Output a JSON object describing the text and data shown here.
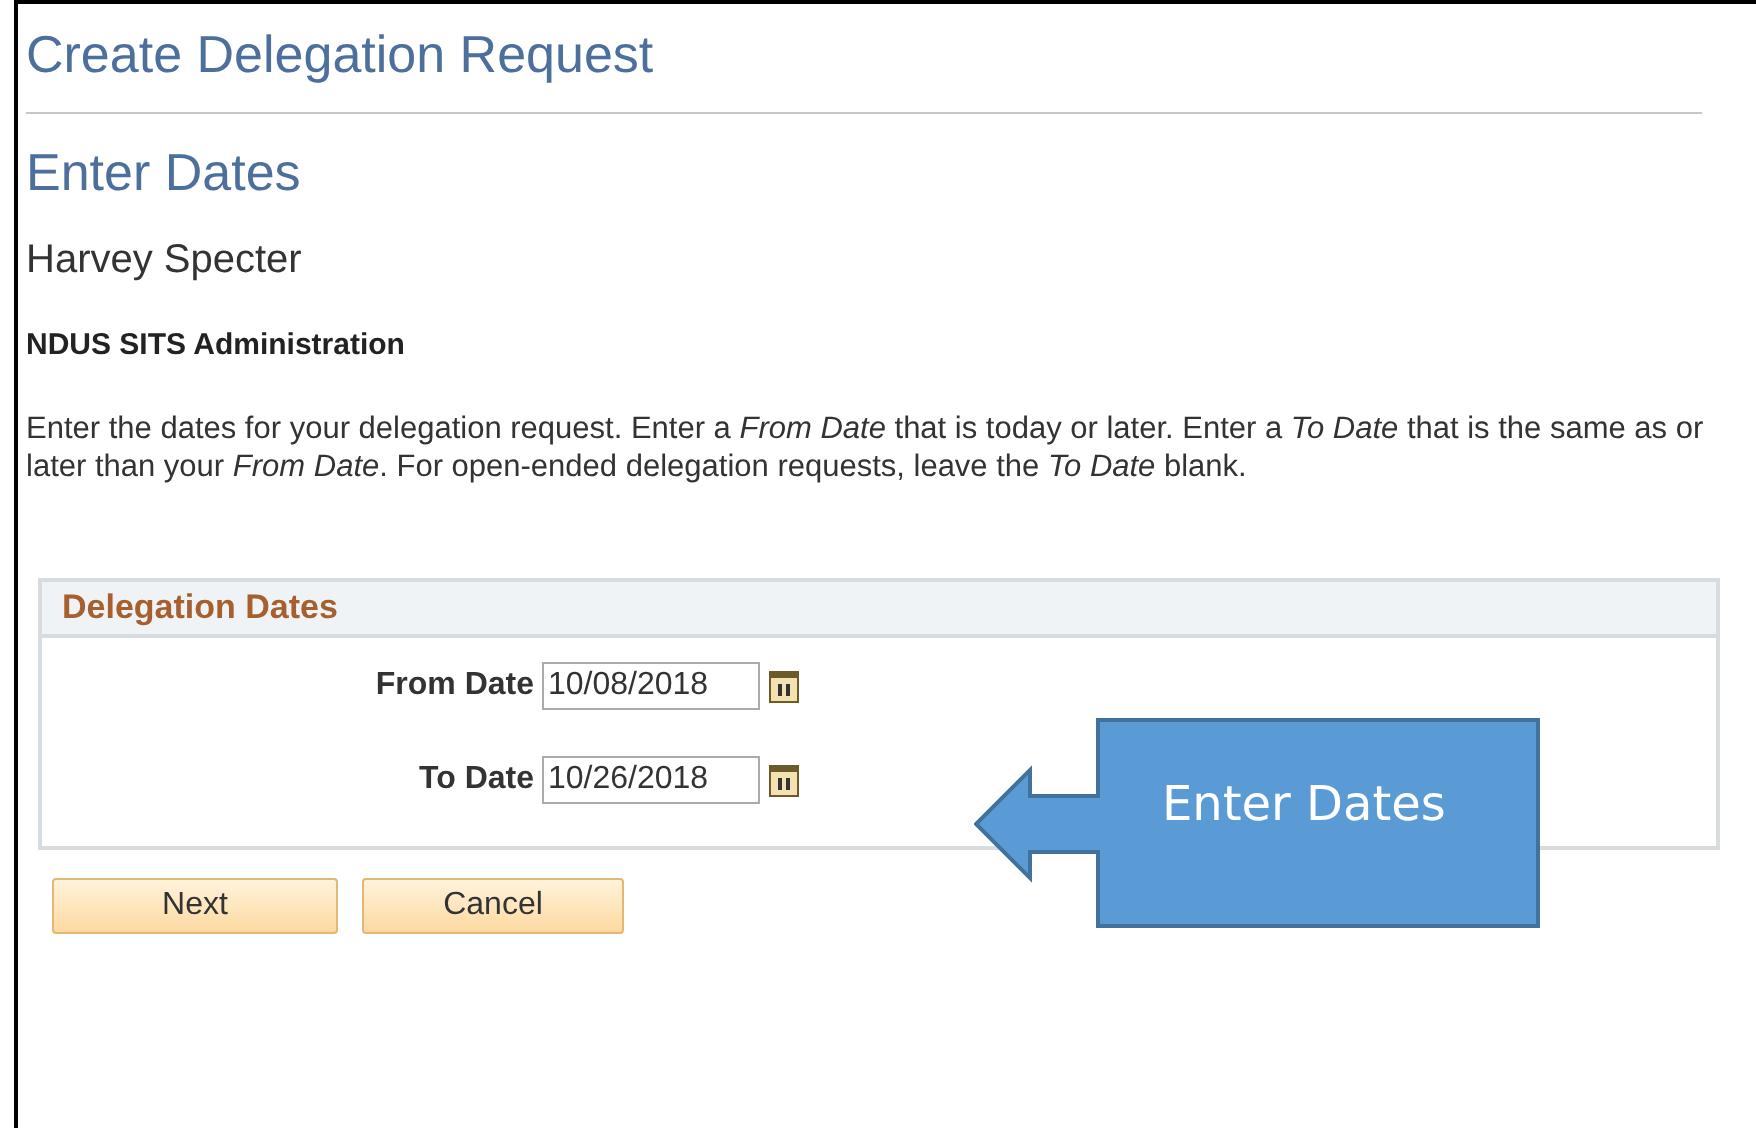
{
  "page_title": "Create Delegation Request",
  "section_title": "Enter Dates",
  "person_name": "Harvey Specter",
  "department": "NDUS SITS Administration",
  "instructions": "Enter the dates for your delegation request. Enter a *From Date* that is today or later. Enter a *To Date* that is the same as or later than your *From Date*. For open-ended delegation requests, leave the *To Date* blank.",
  "group": {
    "title": "Delegation Dates",
    "fields": [
      {
        "label": "From Date",
        "value": "10/08/2018"
      },
      {
        "label": "To Date",
        "value": "10/26/2018"
      }
    ]
  },
  "callout": {
    "text": "Enter Dates"
  },
  "buttons": [
    "Next",
    "Cancel"
  ]
}
